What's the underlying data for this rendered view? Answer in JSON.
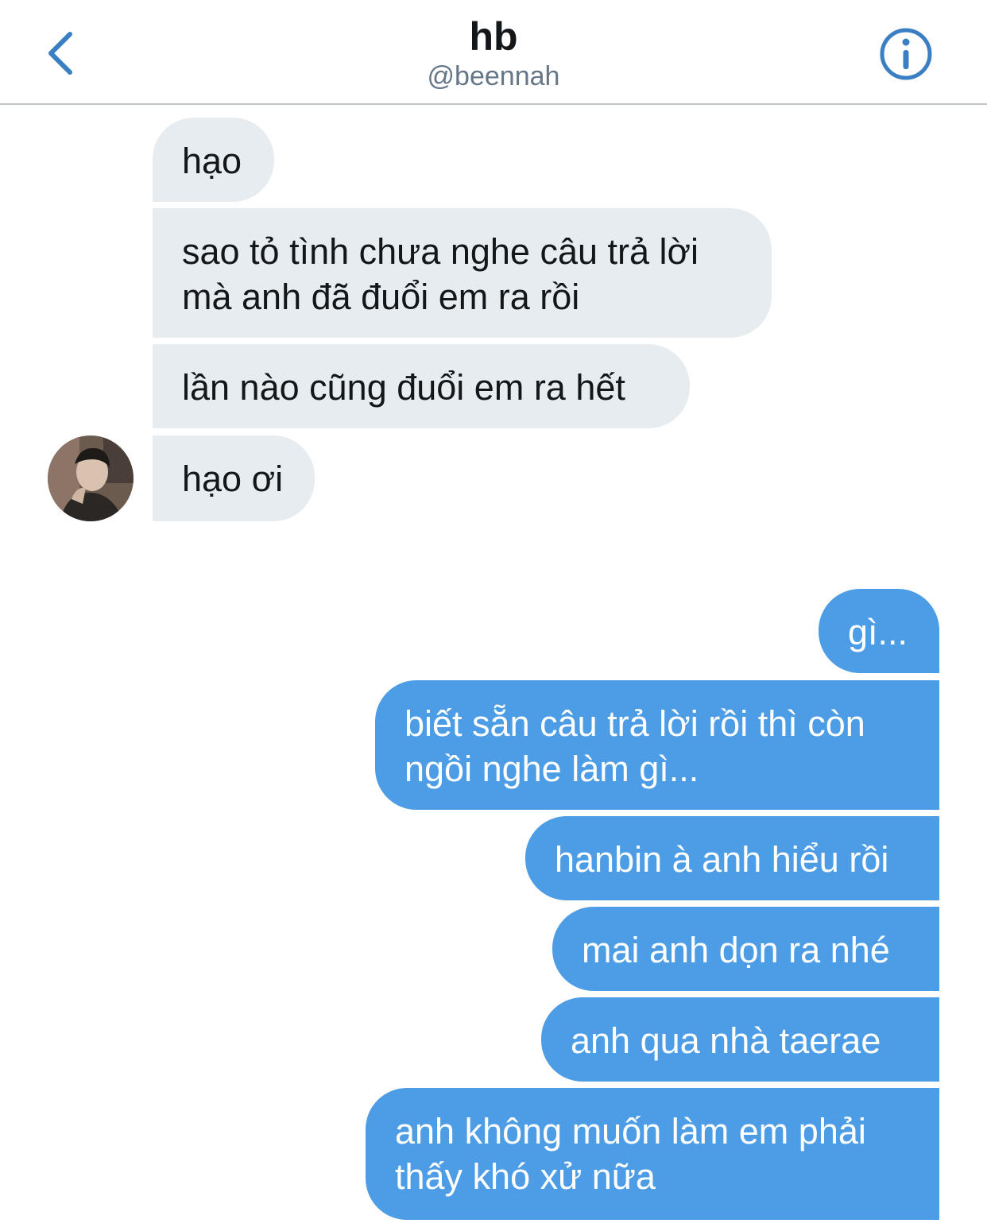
{
  "header": {
    "title": "hb",
    "handle": "@beennah",
    "back_icon": "chevron-left-icon",
    "info_icon": "info-icon",
    "accent_color": "#3a7fc4"
  },
  "messages": {
    "received": [
      {
        "text": "hạo"
      },
      {
        "line1": "sao tỏ tình chưa nghe câu trả lời",
        "line2": "mà anh đã đuổi em ra rồi"
      },
      {
        "text": "lần nào cũng đuổi em ra hết"
      },
      {
        "text": "hạo ơi"
      }
    ],
    "sent": [
      {
        "text": "gì..."
      },
      {
        "line1": "biết sẵn câu trả lời rồi thì còn",
        "line2": "ngồi nghe làm gì..."
      },
      {
        "text": "hanbin à anh hiểu rồi"
      },
      {
        "text": "mai anh dọn ra nhé"
      },
      {
        "text": "anh qua nhà taerae"
      },
      {
        "line1": "anh không muốn làm em phải",
        "line2": "thấy khó xử nữa"
      }
    ]
  },
  "colors": {
    "received_bubble": "#e6ecf0",
    "sent_bubble": "#4d9de6"
  }
}
